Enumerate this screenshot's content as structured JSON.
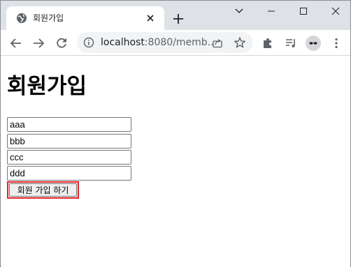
{
  "tab": {
    "title": "회원가입"
  },
  "omnibox": {
    "host": "localhost",
    "rest": ":8080/memb..."
  },
  "page": {
    "heading": "회원가입",
    "fields": [
      "aaa",
      "bbb",
      "ccc",
      "ddd"
    ],
    "submit_label": "회원 가입 하기"
  },
  "colors": {
    "highlight_border": "#e2232a",
    "tabstrip": "#dee1e6"
  },
  "icons": {
    "favicon": "globe-icon",
    "tab_close": "close-icon",
    "new_tab": "plus-icon",
    "back": "arrow-left-icon",
    "forward": "arrow-right-icon",
    "reload": "reload-icon",
    "site_info": "info-icon",
    "share": "share-icon",
    "bookmark": "star-icon",
    "extensions": "puzzle-icon",
    "media": "media-queue-icon",
    "profile": "avatar",
    "menu": "kebab-menu-icon"
  }
}
